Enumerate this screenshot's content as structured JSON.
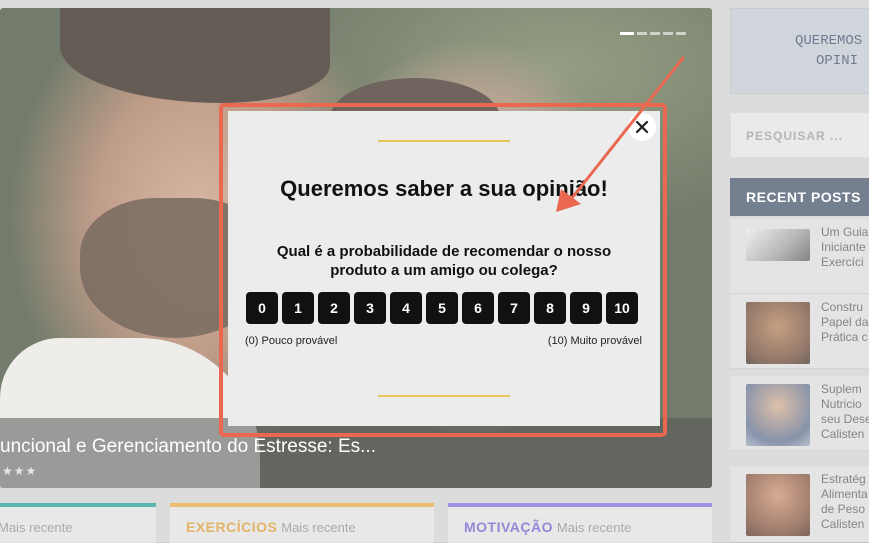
{
  "hero": {
    "title": "uncional e Gerenciamento do Estresse: Es...",
    "stars": "★★★"
  },
  "sidebar": {
    "banner_line1": "QUEREMOS S",
    "banner_line2": "OPINI",
    "search_placeholder": "PESQUISAR ...",
    "recent_heading": "RECENT POSTS",
    "posts": [
      {
        "title": "Um Guia Iniciante Exercíci"
      },
      {
        "title": "Constru Papel da Prática c"
      },
      {
        "title": "Suplem Nutricio seu Dese Calisten"
      },
      {
        "title": "Estratég Alimenta de Peso Calisten"
      }
    ]
  },
  "cards": [
    {
      "category": "",
      "sub": "Mais recente",
      "color": "#1a9a8a"
    },
    {
      "category": "EXERCÍCIOS",
      "sub": "Mais recente",
      "color": "#e6a437"
    },
    {
      "category": "MOTIVAÇÃO",
      "sub": "Mais recente",
      "color": "#7a6ad8"
    }
  ],
  "modal": {
    "title": "Queremos saber a sua opinião!",
    "question": "Qual é a probabilidade de recomendar o nosso produto a um amigo ou colega?",
    "scale": [
      "0",
      "1",
      "2",
      "3",
      "4",
      "5",
      "6",
      "7",
      "8",
      "9",
      "10"
    ],
    "low_label": "(0) Pouco provável",
    "high_label": "(10) Muito provável"
  },
  "colors": {
    "highlight": "#e9684f",
    "accent_line": "#e6c65a",
    "sidebar_head": "#3f4f66"
  },
  "icons": {
    "close": "close-icon",
    "pointer": "arrow-annotation"
  }
}
